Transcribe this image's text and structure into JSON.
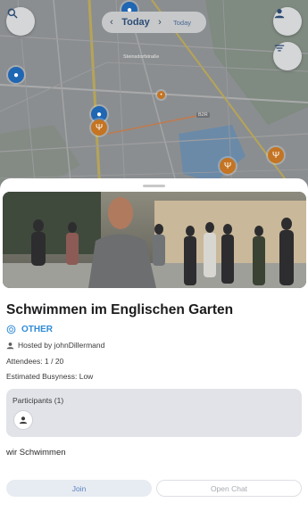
{
  "map": {
    "street_label": "Steinsdorfstraße",
    "road_badge": "B2R",
    "pin_icons": [
      "water-drop-icon",
      "water-drop-icon",
      "water-drop-icon",
      "restaurant-icon",
      "restaurant-icon",
      "restaurant-icon",
      "restaurant-icon"
    ]
  },
  "top_bar": {
    "search_icon": "search-icon",
    "date": {
      "prev": "‹",
      "label": "Today",
      "next": "›",
      "secondary": "Today"
    },
    "profile_icon": "person-icon",
    "filter_icon": "filter-icon"
  },
  "event": {
    "title": "Schwimmen im Englischen Garten",
    "category": "OTHER",
    "host": "Hosted by johnDillermand",
    "attendees": "Attendees: 1 / 20",
    "busyness": "Estimated Busyness: Low",
    "participants_title": "Participants (1)",
    "description": "wir Schwimmen"
  },
  "actions": {
    "join": "Join",
    "open_chat": "Open Chat"
  },
  "colors": {
    "accent": "#2f8bd6",
    "join_bg": "#e7ebf2",
    "participants_bg": "#e1e3e8",
    "pin_blue": "#1f66b3",
    "pin_orange": "#c47422"
  }
}
